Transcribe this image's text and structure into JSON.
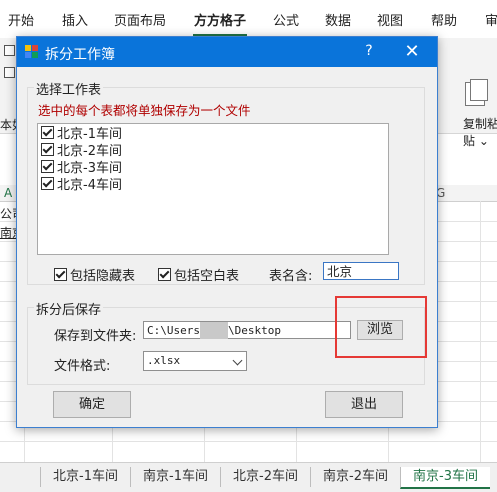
{
  "ribbon": {
    "tabs": [
      "开始",
      "插入",
      "页面布局",
      "方方格子",
      "公式",
      "数据",
      "视图",
      "帮助"
    ],
    "right_tab": "审",
    "copy_label_line1": "复制粘",
    "copy_label_line2": "贴",
    "partial_text_1": "本如"
  },
  "grid": {
    "columns": [
      "A",
      "G"
    ],
    "cells": [
      "公司",
      "南京"
    ]
  },
  "sheets": {
    "tabs": [
      "北京-1车间",
      "南京-1车间",
      "北京-2车间",
      "南京-2车间",
      "南京-3车间"
    ],
    "active_index": 4
  },
  "dialog": {
    "title": "拆分工作簿",
    "help": "?",
    "close": "✕",
    "select_group": {
      "legend": "选择工作表",
      "hint": "选中的每个表都将单独保存为一个文件",
      "items": [
        {
          "label": "北京-1车间",
          "checked": true
        },
        {
          "label": "北京-2车间",
          "checked": true
        },
        {
          "label": "北京-3车间",
          "checked": true
        },
        {
          "label": "北京-4车间",
          "checked": true
        }
      ],
      "include_hidden": "包括隐藏表",
      "include_blank": "包括空白表",
      "name_contains_label": "表名含:",
      "name_contains_value": "北京"
    },
    "save_group": {
      "legend": "拆分后保存",
      "save_to_label": "保存到文件夹:",
      "path_prefix": "C:\\Users",
      "path_suffix": "\\Desktop",
      "browse": "浏览",
      "format_label": "文件格式:",
      "format_value": ".xlsx"
    },
    "ok": "确定",
    "cancel": "退出"
  },
  "colors": {
    "title_bar": "#0a74da",
    "excel_green": "#217346",
    "hint_red": "#b00000",
    "highlight_red": "#e53935"
  }
}
